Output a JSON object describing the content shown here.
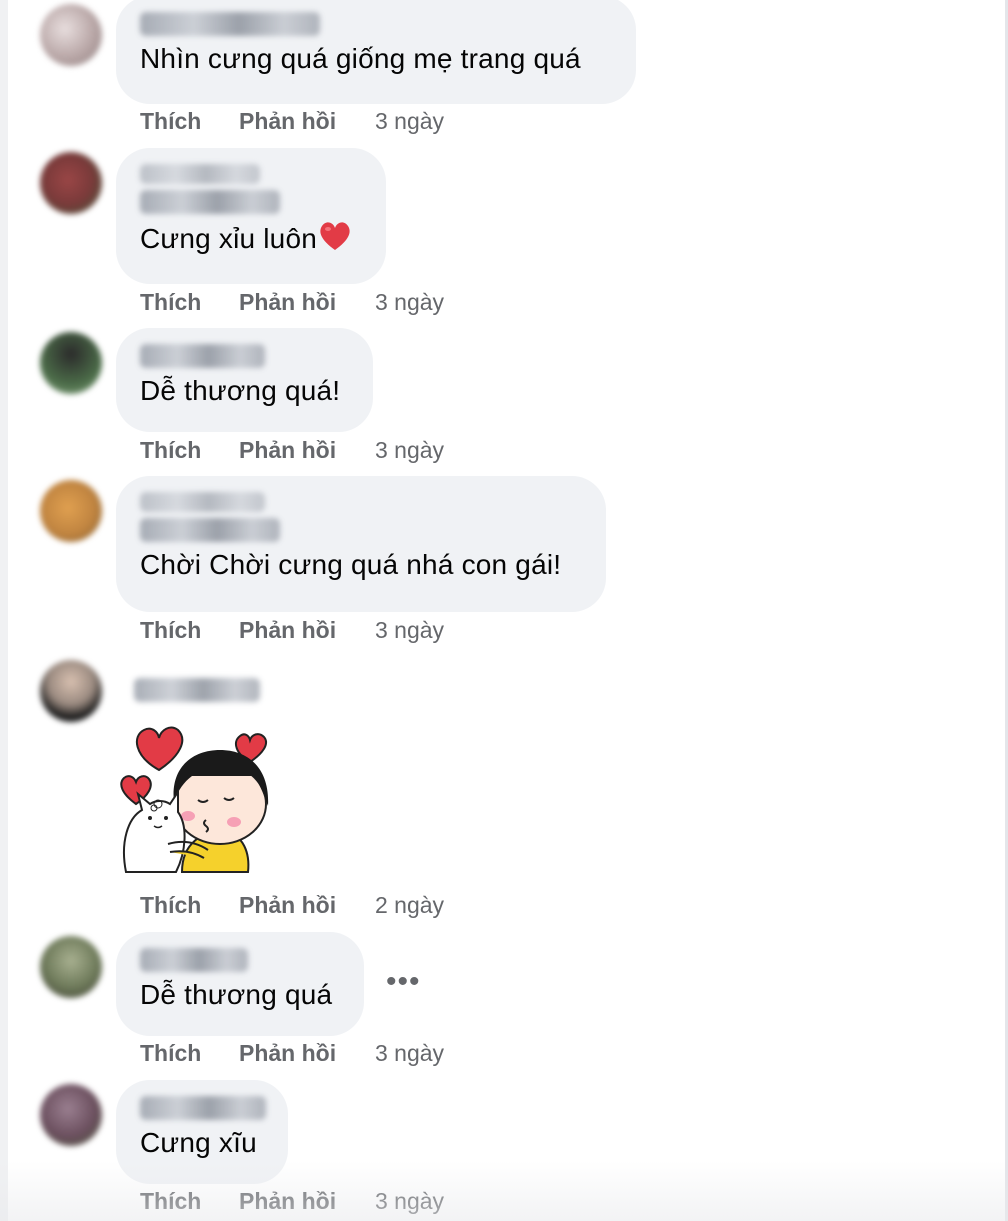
{
  "actions": {
    "like_label": "Thích",
    "reply_label": "Phản hồi"
  },
  "more_label": "•••",
  "comments": [
    {
      "text": "Nhìn cưng quá giống mẹ trang quá",
      "time": "3 ngày",
      "avatar_color": "#b9a7a7"
    },
    {
      "text": "Cưng xỉu luôn",
      "time": "3 ngày",
      "avatar_color": "#7a3a3a",
      "emoji": "heart-icon"
    },
    {
      "text": "Dễ thương quá!",
      "time": "3 ngày",
      "avatar_color": "#4b6b48"
    },
    {
      "text": "Chời Chời cưng quá nhá con gái!",
      "time": "3 ngày",
      "avatar_color": "#c08440"
    },
    {
      "sticker": "girl-hugging-cat-sticker",
      "time": "2 ngày",
      "avatar_color": "#3a3a3a"
    },
    {
      "text": "Dễ thương quá",
      "time": "3 ngày",
      "avatar_color": "#6e7a5a"
    },
    {
      "text": "Cưng xĩu",
      "time": "3 ngày",
      "avatar_color": "#6b4f5e"
    }
  ],
  "colors": {
    "bubble": "#f0f2f5",
    "meta_text": "#65676b",
    "heart": "#e23b46"
  }
}
